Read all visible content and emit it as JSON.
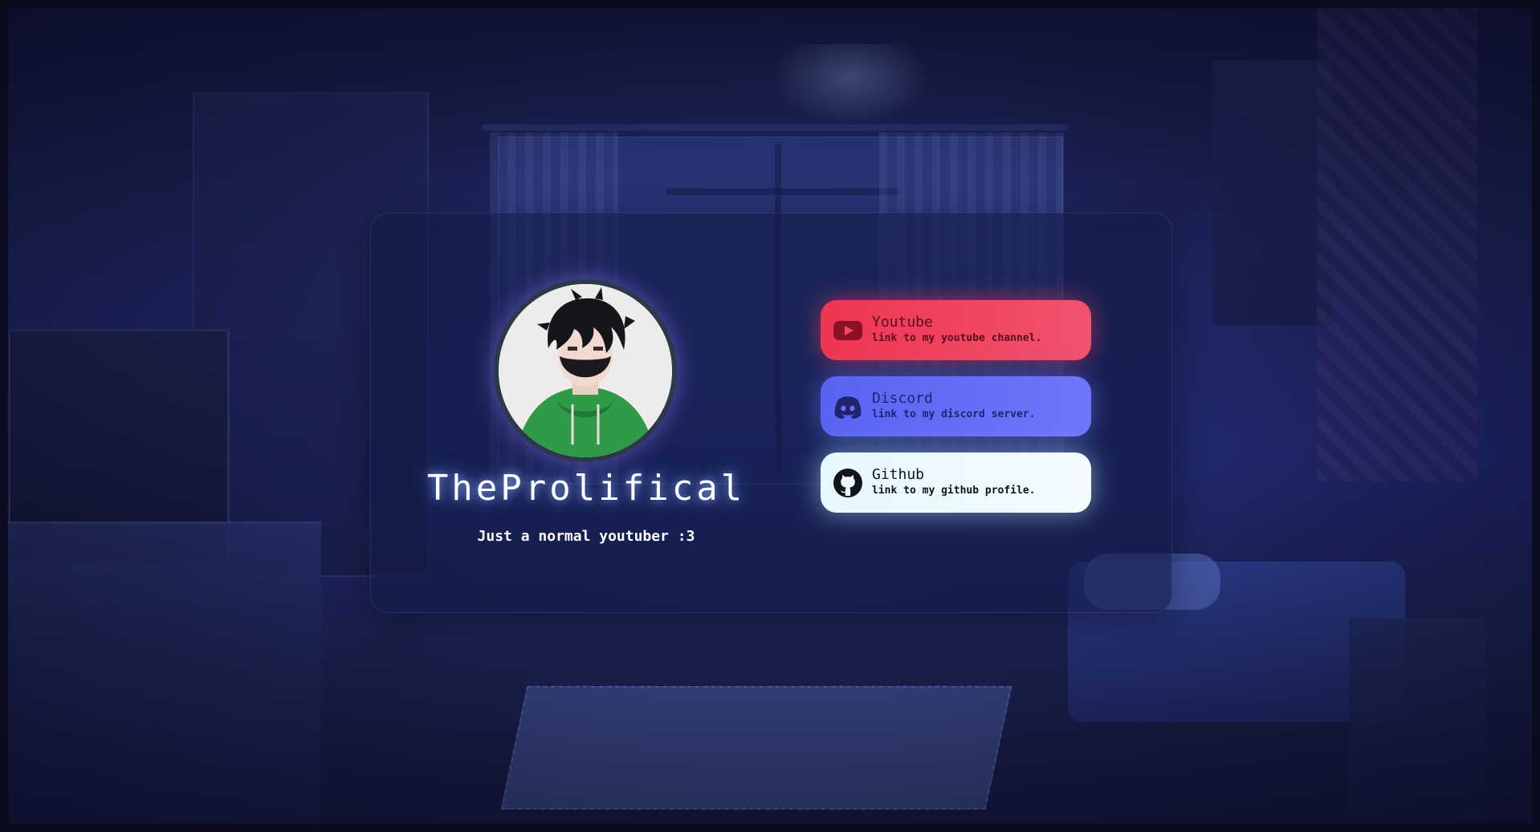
{
  "profile": {
    "name": "TheProlifical",
    "bio": "Just a normal youtuber :3",
    "avatar_icon": "avatar-masked-boy-green-hoodie"
  },
  "links": [
    {
      "title": "Youtube",
      "description": "link to my youtube channel.",
      "icon": "youtube-icon",
      "color": "#ef3552"
    },
    {
      "title": "Discord",
      "description": "link to my discord server.",
      "icon": "discord-icon",
      "color": "#5a63f2"
    },
    {
      "title": "Github",
      "description": "link to my github profile.",
      "icon": "github-icon",
      "color": "#e6f8ff"
    }
  ],
  "colors": {
    "card_bg": "#12203f",
    "name_glow": "#8caaff",
    "page_bg": "#1b2257"
  }
}
